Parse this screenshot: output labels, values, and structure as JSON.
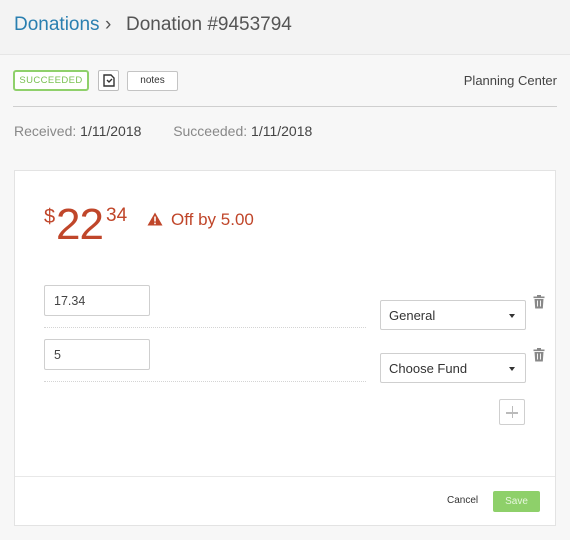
{
  "breadcrumb": {
    "parent": "Donations",
    "separator": "›",
    "current": "Donation #9453794"
  },
  "toolbar": {
    "status_badge": "SUCCEEDED",
    "receipt_icon": "receipt-icon",
    "notes_label": "notes",
    "source": "Planning Center"
  },
  "dates": {
    "received_label": "Received:",
    "received_value": "1/11/2018",
    "succeeded_label": "Succeeded:",
    "succeeded_value": "1/11/2018"
  },
  "amount": {
    "currency": "$",
    "dollars": "22",
    "cents": "34",
    "warning": "Off by 5.00",
    "warning_icon": "warning-triangle-icon",
    "color": "#c0462a"
  },
  "designations": [
    {
      "amount": "17.34",
      "fund": "General"
    },
    {
      "amount": "5",
      "fund": "Choose Fund"
    }
  ],
  "footer": {
    "cancel_label": "Cancel",
    "save_label": "Save"
  },
  "colors": {
    "link": "#2a7fb0",
    "success": "#79c152",
    "save_button": "#8ed06a"
  }
}
